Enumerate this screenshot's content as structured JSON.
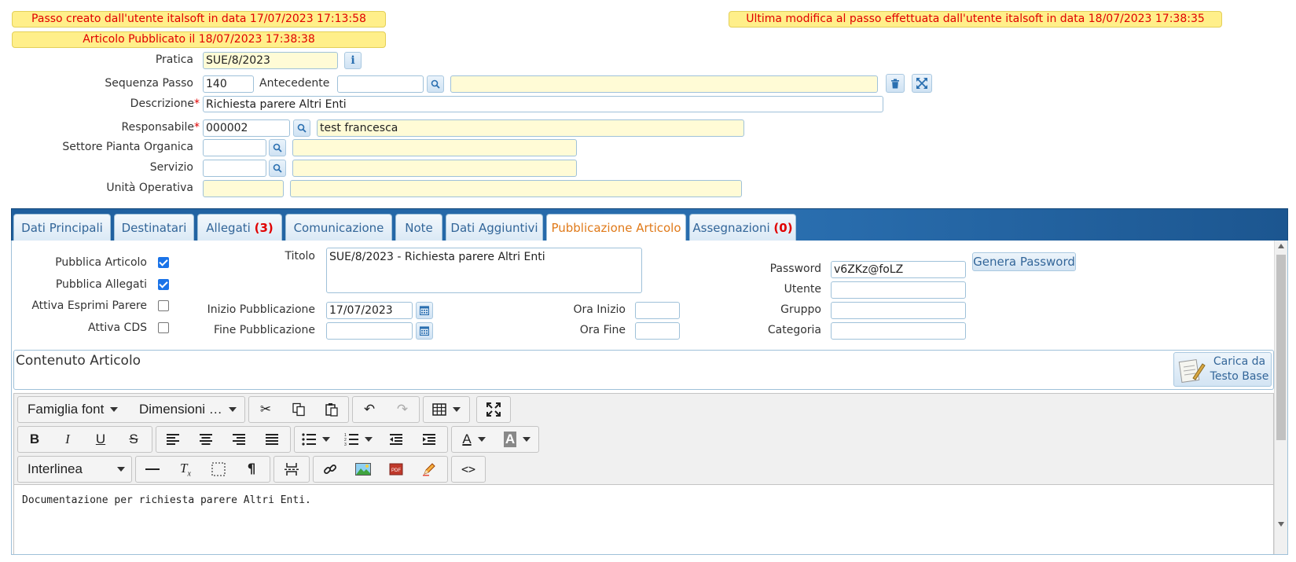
{
  "banners": {
    "created": "Passo creato dall'utente italsoft in data 17/07/2023 17:13:58",
    "published": "Articolo Pubblicato il 18/07/2023 17:38:38",
    "modified": "Ultima modifica al passo effettuata dall'utente italsoft in data 18/07/2023 17:38:35"
  },
  "form": {
    "pratica_label": "Pratica",
    "pratica_value": "SUE/8/2023",
    "sequenza_label": "Sequenza Passo",
    "sequenza_value": "140",
    "antecedente_label": "Antecedente",
    "antecedente_value": "",
    "antecedente_desc": "",
    "descrizione_label": "Descrizione",
    "descrizione_value": "Richiesta parere Altri Enti",
    "responsabile_label": "Responsabile",
    "responsabile_code": "000002",
    "responsabile_name": "test francesca",
    "settore_label": "Settore Pianta Organica",
    "settore_code": "",
    "settore_desc": "",
    "servizio_label": "Servizio",
    "servizio_code": "",
    "servizio_desc": "",
    "unita_label": "Unità Operativa",
    "unita_code": "",
    "unita_desc": "",
    "required_mark": "*"
  },
  "tabs": [
    {
      "label": "Dati Principali",
      "count": ""
    },
    {
      "label": "Destinatari",
      "count": ""
    },
    {
      "label": "Allegati",
      "count": "(3)"
    },
    {
      "label": "Comunicazione",
      "count": ""
    },
    {
      "label": "Note",
      "count": ""
    },
    {
      "label": "Dati Aggiuntivi",
      "count": ""
    },
    {
      "label": "Pubblicazione Articolo",
      "count": ""
    },
    {
      "label": "Assegnazioni",
      "count": "(0)"
    }
  ],
  "pub": {
    "pubblica_articolo": "Pubblica Articolo",
    "pubblica_allegati": "Pubblica Allegati",
    "esprimi_parere": "Attiva Esprimi Parere",
    "attiva_cds": "Attiva CDS",
    "titolo_label": "Titolo",
    "titolo_value": "SUE/8/2023 - Richiesta parere Altri Enti",
    "inizio_label": "Inizio Pubblicazione",
    "inizio_value": "17/07/2023",
    "fine_label": "Fine Pubblicazione",
    "fine_value": "",
    "ora_inizio_label": "Ora Inizio",
    "ora_fine_label": "Ora Fine",
    "password_label": "Password",
    "password_value": "v6ZKz@foLZ",
    "genera_password": "Genera Password",
    "utente_label": "Utente",
    "gruppo_label": "Gruppo",
    "categoria_label": "Categoria"
  },
  "contenuto": {
    "title": "Contenuto Articolo",
    "carica_line1": "Carica da",
    "carica_line2": "Testo Base"
  },
  "editor": {
    "font_family": "Famiglia font",
    "font_size": "Dimensioni …",
    "line_height": "Interlinea",
    "body_text": "Documentazione per richiesta parere Altri Enti."
  }
}
